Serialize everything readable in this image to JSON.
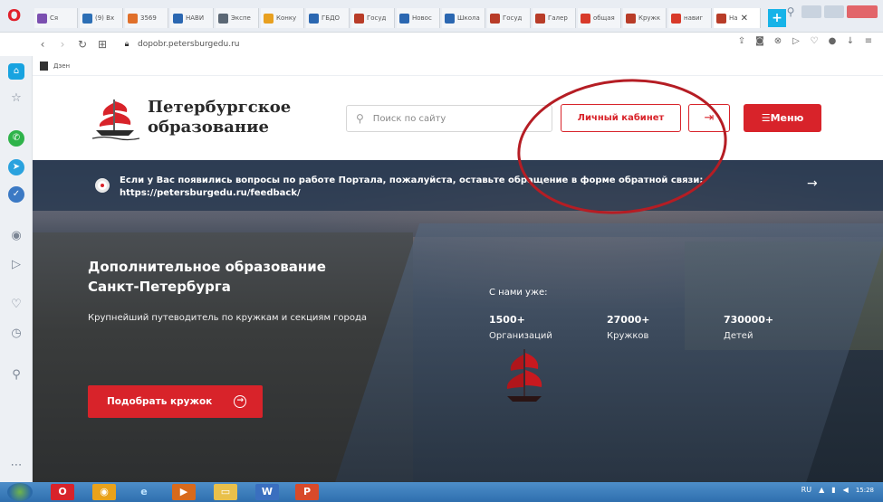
{
  "browser": {
    "tabs": [
      {
        "label": "Ся",
        "color": "#7b4fb0"
      },
      {
        "label": "(9) Вх",
        "color": "#2d6fb5"
      },
      {
        "label": "3569",
        "color": "#e0702b"
      },
      {
        "label": "НАВИ",
        "color": "#2b67b1"
      },
      {
        "label": "Экспе",
        "color": "#5b6775"
      },
      {
        "label": "Конку",
        "color": "#e8a020"
      },
      {
        "label": "ГБДО",
        "color": "#2b67b1"
      },
      {
        "label": "Госуд",
        "color": "#b83c28"
      },
      {
        "label": "Новос",
        "color": "#2b67b1"
      },
      {
        "label": "Школа",
        "color": "#2b67b1"
      },
      {
        "label": "Госуд",
        "color": "#b83c28"
      },
      {
        "label": "Галер",
        "color": "#b83c28"
      },
      {
        "label": "общая",
        "color": "#d83a2a"
      },
      {
        "label": "Кружк",
        "color": "#b83c28"
      },
      {
        "label": "навиг",
        "color": "#d83a2a"
      }
    ],
    "active_tab": {
      "label": "На",
      "close": "✕"
    },
    "new_tab": "+",
    "url": "dopobr.petersburgedu.ru",
    "bookmark": "Дзен"
  },
  "header": {
    "logo_line1": "Петербургское",
    "logo_line2": "образование",
    "search_placeholder": "Поиск по сайту",
    "cabinet_label": "Личный кабинет",
    "login_icon": "⇥",
    "menu_label": "☰Меню"
  },
  "notice": {
    "text": "Если у Вас появились вопросы по работе Портала, пожалуйста, оставьте обращение в форме обратной связи: https://petersburgedu.ru/feedback/",
    "arrow": "→"
  },
  "hero": {
    "title": "Дополнительное образование Санкт-Петербурга",
    "subtitle": "Крупнейший путеводитель по кружкам и секциям города",
    "cta_label": "Подобрать кружок",
    "cta_icon": "→",
    "stats_label": "С нами уже:",
    "stats": [
      {
        "num": "1500+",
        "label": "Организаций"
      },
      {
        "num": "27000+",
        "label": "Кружков"
      },
      {
        "num": "730000+",
        "label": "Детей"
      }
    ]
  },
  "colors": {
    "brand_red": "#d8232a",
    "annotation_red": "#b51d24"
  },
  "taskbar": {
    "lang": "RU",
    "time": "15:28"
  }
}
